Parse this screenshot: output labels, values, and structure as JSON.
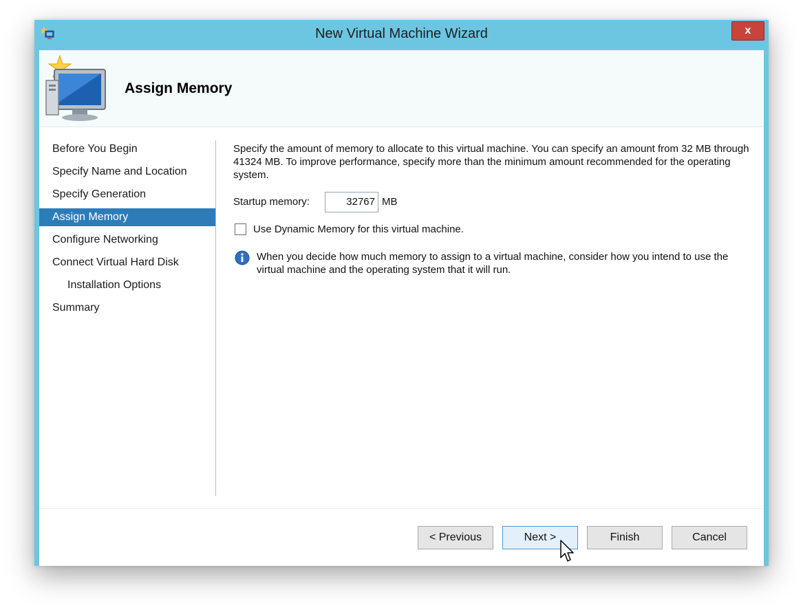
{
  "window": {
    "title": "New Virtual Machine Wizard",
    "close_label": "x"
  },
  "header": {
    "page_title": "Assign Memory"
  },
  "nav": {
    "items": [
      {
        "label": "Before You Begin",
        "active": false,
        "sub": false
      },
      {
        "label": "Specify Name and Location",
        "active": false,
        "sub": false
      },
      {
        "label": "Specify Generation",
        "active": false,
        "sub": false
      },
      {
        "label": "Assign Memory",
        "active": true,
        "sub": false
      },
      {
        "label": "Configure Networking",
        "active": false,
        "sub": false
      },
      {
        "label": "Connect Virtual Hard Disk",
        "active": false,
        "sub": false
      },
      {
        "label": "Installation Options",
        "active": false,
        "sub": true
      },
      {
        "label": "Summary",
        "active": false,
        "sub": false
      }
    ]
  },
  "content": {
    "description": "Specify the amount of memory to allocate to this virtual machine. You can specify an amount from 32 MB through 41324 MB. To improve performance, specify more than the minimum amount recommended for the operating system.",
    "startup_memory_label": "Startup memory:",
    "startup_memory_value": "32767",
    "startup_memory_unit": "MB",
    "dynamic_memory_label": "Use Dynamic Memory for this virtual machine.",
    "dynamic_memory_checked": false,
    "info_text": "When you decide how much memory to assign to a virtual machine, consider how you intend to use the virtual machine and the operating system that it will run."
  },
  "buttons": {
    "previous": "< Previous",
    "next": "Next >",
    "finish": "Finish",
    "cancel": "Cancel"
  },
  "colors": {
    "titlebar": "#6cc6e2",
    "nav_active": "#2d7cb8",
    "close_button": "#c8443a"
  },
  "icons": [
    "app-icon",
    "close-icon",
    "new-vm-wizard-icon",
    "info-icon",
    "mouse-cursor-icon"
  ]
}
